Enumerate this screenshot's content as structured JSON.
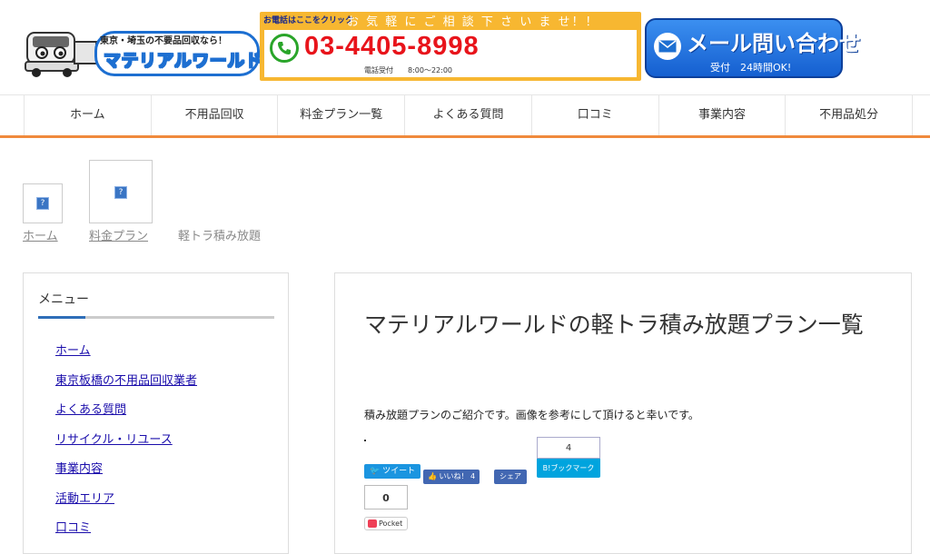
{
  "header": {
    "logo": {
      "tagline": "東京・埼玉の不要品回収なら！",
      "brand": "マテリアルワールド"
    },
    "phone": {
      "click_hint": "お電話はここをクリック",
      "message": "お 気 軽 に ご 相 談 下 さ い ま せ！！",
      "number": "03-4405-8998",
      "hours": "電話受付　　8:00〜22:00"
    },
    "mail": {
      "label": "メール問い合わせ",
      "sub": "受付　24時間OK!"
    }
  },
  "nav": {
    "items": [
      "ホーム",
      "不用品回収",
      "料金プラン一覧",
      "よくある質問",
      "口コミ",
      "事業内容",
      "不用品処分"
    ]
  },
  "breadcrumb": {
    "home": "ホーム",
    "plan": "料金プラン",
    "current": "軽トラ積み放題",
    "broken_image_glyph": "?"
  },
  "sidebar": {
    "title": "メニュー",
    "items": [
      "ホーム",
      "東京板橋の不用品回収業者",
      "よくある質問",
      "リサイクル・リユース",
      "事業内容",
      "活動エリア",
      "口コミ"
    ]
  },
  "main": {
    "title": "マテリアルワールドの軽トラ積み放題プラン一覧",
    "lead": "積み放題プランのご紹介です。画像を参考にして頂けると幸いです。",
    "social": {
      "tweet": "ツイート",
      "like": "いいね！ 4",
      "share": "シェア",
      "hatena_count": "4",
      "hatena_label": "B!ブックマーク",
      "pocket_count": "0",
      "pocket_label": "Pocket"
    }
  },
  "colors": {
    "nav_accent": "#f08a3c",
    "phone_bg": "#f7b731",
    "phone_number": "#e8141b",
    "mail_button": "#1d6fd1",
    "sidebar_accent": "#2f6eb8"
  }
}
